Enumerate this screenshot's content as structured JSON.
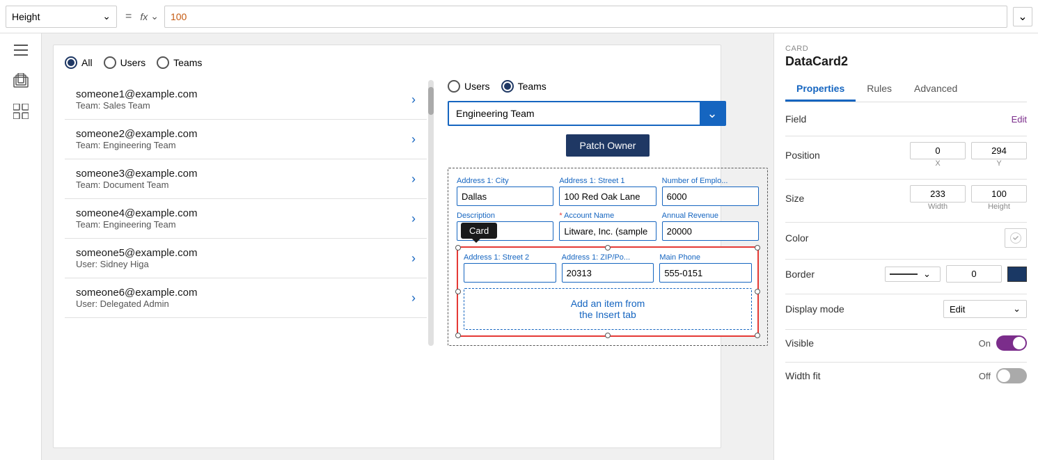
{
  "topbar": {
    "height_label": "Height",
    "equals": "=",
    "fx_label": "fx",
    "formula_value": "100",
    "dropdown_arrow": "∨"
  },
  "sidebar": {
    "icons": [
      "≡",
      "◫",
      "⊞"
    ]
  },
  "canvas": {
    "radio_group": {
      "options": [
        "All",
        "Users",
        "Teams"
      ],
      "selected": "All"
    },
    "contacts": [
      {
        "email": "someone1@example.com",
        "team": "Team: Sales Team"
      },
      {
        "email": "someone2@example.com",
        "team": "Team: Engineering Team"
      },
      {
        "email": "someone3@example.com",
        "team": "Team: Document Team"
      },
      {
        "email": "someone4@example.com",
        "team": "Team: Engineering Team"
      },
      {
        "email": "someone5@example.com",
        "team": "User: Sidney Higa"
      },
      {
        "email": "someone6@example.com",
        "team": "User: Delegated Admin"
      }
    ]
  },
  "owner_panel": {
    "radio_options": [
      "Users",
      "Teams"
    ],
    "selected": "Teams",
    "dropdown_value": "Engineering Team",
    "patch_button": "Patch Owner",
    "form_fields": [
      {
        "label": "Address 1: City",
        "value": "Dallas",
        "required": false
      },
      {
        "label": "Address 1: Street 1",
        "value": "100 Red Oak Lane",
        "required": false
      },
      {
        "label": "Number of Emplo...",
        "value": "6000",
        "required": false
      },
      {
        "label": "Description",
        "value": "",
        "required": false
      },
      {
        "label": "Account Name",
        "value": "Litware, Inc. (sample",
        "required": true
      },
      {
        "label": "Annual Revenue",
        "value": "20000",
        "required": false
      },
      {
        "label": "Address 1: Street 2",
        "value": "",
        "required": false
      },
      {
        "label": "Address 1: ZIP/Po...",
        "value": "20313",
        "required": false
      },
      {
        "label": "Main Phone",
        "value": "555-0151",
        "required": false
      }
    ],
    "card_tooltip": "Card",
    "add_item_text": "Add an item from\nthe Insert tab"
  },
  "properties": {
    "card_label": "CARD",
    "title": "DataCard2",
    "tabs": [
      "Properties",
      "Rules",
      "Advanced"
    ],
    "active_tab": "Properties",
    "field_label": "Field",
    "field_edit": "Edit",
    "position_label": "Position",
    "pos_x": "0",
    "pos_y": "294",
    "size_label": "Size",
    "size_width": "233",
    "size_height": "100",
    "color_label": "Color",
    "border_label": "Border",
    "border_value": "0",
    "display_mode_label": "Display mode",
    "display_mode_value": "Edit",
    "visible_label": "Visible",
    "visible_on": "On",
    "visible_state": "on",
    "width_fit_label": "Width fit",
    "width_fit_off": "Off",
    "width_fit_state": "off",
    "x_label": "X",
    "y_label": "Y",
    "width_label": "Width",
    "height_label": "Height"
  }
}
